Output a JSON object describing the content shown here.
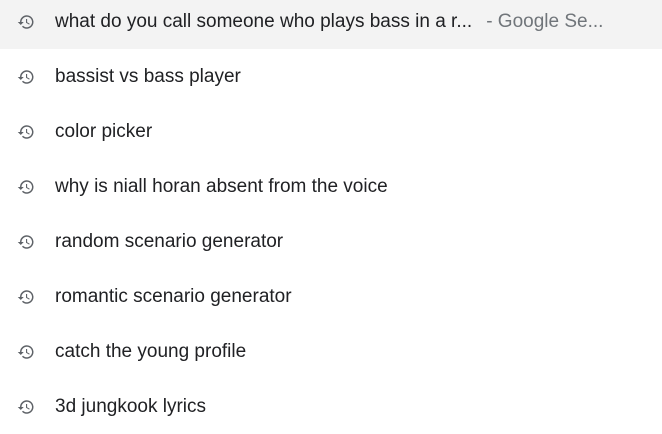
{
  "suggestions": [
    {
      "icon": "history-icon",
      "text": "what do you call someone who plays bass in a r...",
      "suffix": "- Google Se..."
    },
    {
      "icon": "history-icon",
      "text": "bassist vs bass player"
    },
    {
      "icon": "history-icon",
      "text": "color picker"
    },
    {
      "icon": "history-icon",
      "text": "why is niall horan absent from the voice"
    },
    {
      "icon": "history-icon",
      "text": "random scenario generator"
    },
    {
      "icon": "history-icon",
      "text": "romantic scenario generator"
    },
    {
      "icon": "history-icon",
      "text": "catch the young profile"
    },
    {
      "icon": "history-icon",
      "text": "3d jungkook lyrics"
    }
  ],
  "colors": {
    "text": "#202124",
    "secondary_text": "#70757a",
    "icon": "#5f6368",
    "background": "#ffffff"
  }
}
